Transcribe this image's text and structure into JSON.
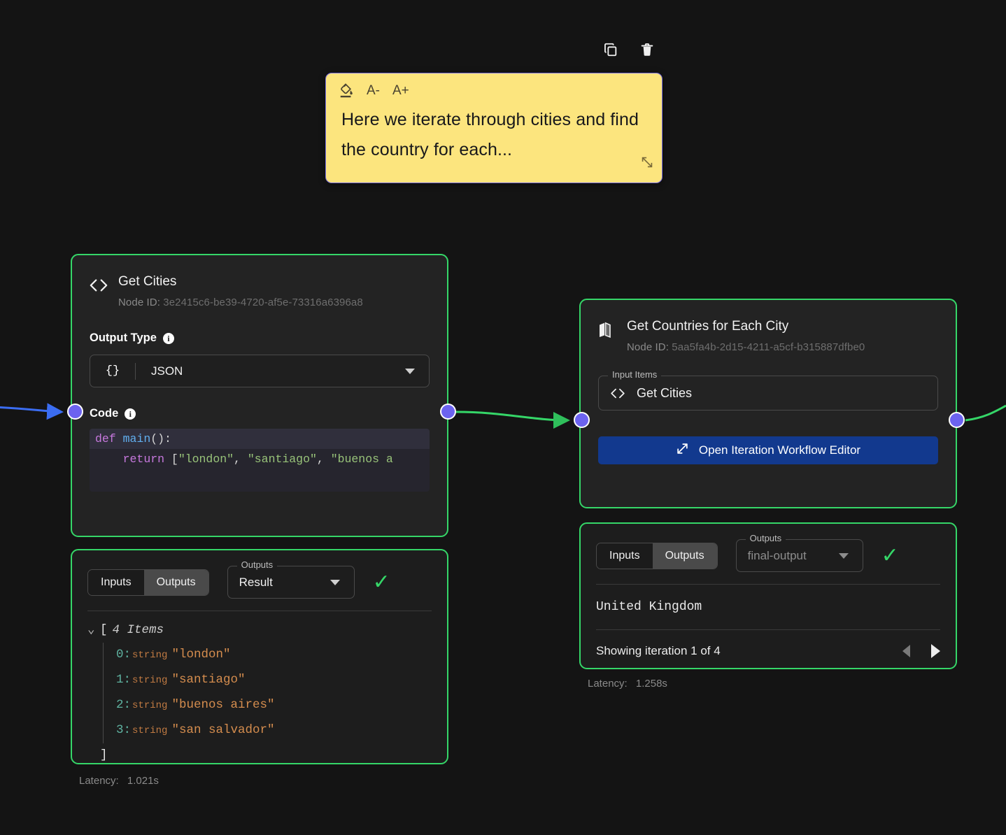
{
  "toolbar": {
    "copy_label": "copy-icon",
    "delete_label": "trash-icon"
  },
  "sticky_note": {
    "fill_label": "",
    "font_decrease_label": "A-",
    "font_increase_label": "A+",
    "text": "Here we iterate through cities and find the country for each...",
    "background_color": "#FCE57E",
    "border_color": "#7a70e0"
  },
  "nodes": [
    {
      "title": "Get Cities",
      "node_id_label": "Node ID:",
      "node_id": "3e2415c6-be39-4720-af5e-73316a6396a8",
      "icon": "code-brackets-icon",
      "output_type": {
        "label": "Output Type",
        "icon": "json-braces-icon",
        "value": "JSON"
      },
      "code": {
        "label": "Code",
        "lines": [
          [
            {
              "t": "def ",
              "c": "tk-kw"
            },
            {
              "t": "main",
              "c": "tk-fn"
            },
            {
              "t": "():",
              "c": "tk-pl"
            }
          ],
          [
            {
              "t": "    ",
              "c": "tk-pl"
            },
            {
              "t": "return ",
              "c": "tk-kw"
            },
            {
              "t": "[",
              "c": "tk-pl"
            },
            {
              "t": "\"london\"",
              "c": "tk-str"
            },
            {
              "t": ", ",
              "c": "tk-pl"
            },
            {
              "t": "\"santiago\"",
              "c": "tk-str"
            },
            {
              "t": ", ",
              "c": "tk-pl"
            },
            {
              "t": "\"buenos a",
              "c": "tk-str"
            }
          ]
        ]
      }
    },
    {
      "title": "Get Countries for Each City",
      "node_id_label": "Node ID:",
      "node_id": "5aa5fa4b-2d15-4211-a5cf-b315887dfbe0",
      "icon": "map-icon",
      "input_items": {
        "legend": "Input Items",
        "icon": "code-brackets-icon",
        "value": "Get Cities"
      },
      "action_button": {
        "label": "Open Iteration Workflow Editor",
        "icon": "expand-diagonal-icon",
        "color": "#12398e"
      }
    }
  ],
  "result_panels": [
    {
      "tabs": [
        "Inputs",
        "Outputs"
      ],
      "active_tab": "Outputs",
      "selector": {
        "legend": "Outputs",
        "value": "Result"
      },
      "status_icon": "check-icon",
      "json": {
        "header": "4 Items",
        "open_bracket": "[",
        "close_bracket": "]",
        "rows": [
          {
            "index": "0:",
            "type": "string",
            "value": "\"london\""
          },
          {
            "index": "1:",
            "type": "string",
            "value": "\"santiago\""
          },
          {
            "index": "2:",
            "type": "string",
            "value": "\"buenos aires\""
          },
          {
            "index": "3:",
            "type": "string",
            "value": "\"san salvador\""
          }
        ]
      },
      "latency_label": "Latency:",
      "latency_value": "1.021s"
    },
    {
      "tabs": [
        "Inputs",
        "Outputs"
      ],
      "active_tab": "Outputs",
      "selector": {
        "legend": "Outputs",
        "value": "final-output"
      },
      "status_icon": "check-icon",
      "output_value": "United Kingdom",
      "iteration_label": "Showing iteration 1 of 4",
      "prev_label": "previous-iteration",
      "next_label": "next-iteration",
      "latency_label": "Latency:",
      "latency_value": "1.258s"
    }
  ],
  "colors": {
    "canvas_bg": "#141414",
    "node_border_active": "#35d668",
    "handle": "#6c63f0",
    "edge_green": "#35d668",
    "edge_blue": "#3b6df2"
  }
}
